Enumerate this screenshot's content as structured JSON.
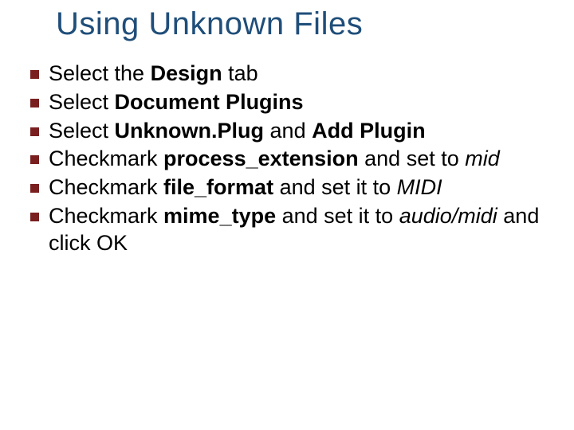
{
  "title": "Using Unknown Files",
  "bullets": {
    "b0": {
      "s0": "Select the ",
      "s1": "Design",
      "s2": " tab"
    },
    "b1": {
      "s0": "Select ",
      "s1": "Document Plugins"
    },
    "b2": {
      "s0": "Select ",
      "s1": "Unknown.Plug",
      "s2": " and ",
      "s3": "Add Plugin"
    },
    "b3": {
      "s0": "Checkmark ",
      "s1": "process_extension",
      "s2": " and set to ",
      "s3": "mid"
    },
    "b4": {
      "s0": "Checkmark ",
      "s1": "file_format",
      "s2": " and set it to ",
      "s3": "MIDI"
    },
    "b5": {
      "s0": "Checkmark ",
      "s1": "mime_type",
      "s2": " and set it to ",
      "s3": "audio/midi",
      "s4": " and click OK"
    }
  }
}
